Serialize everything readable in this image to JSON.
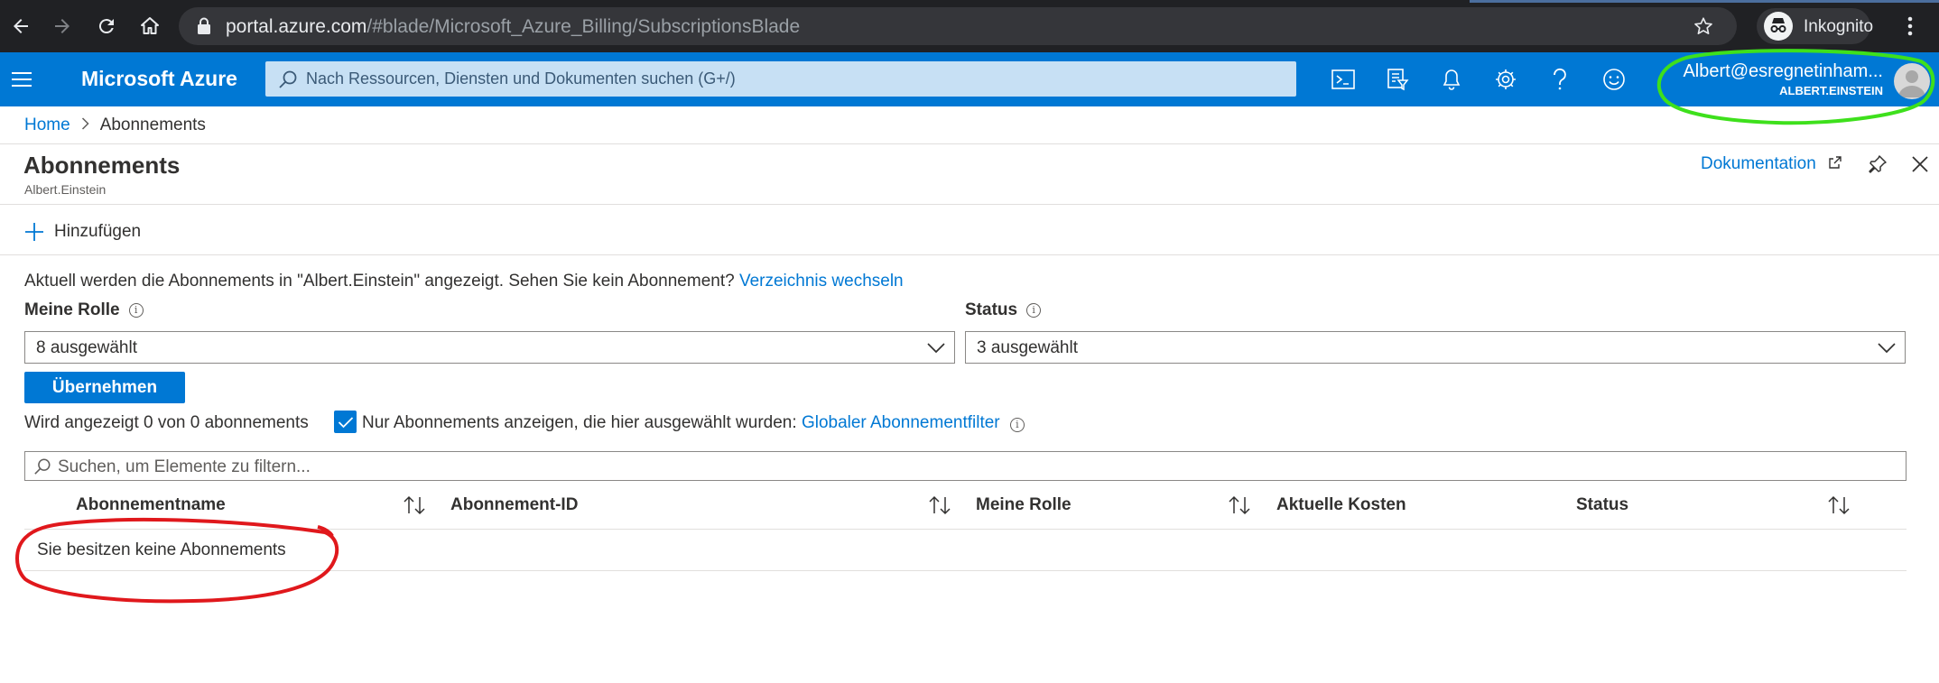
{
  "browser": {
    "url_host": "portal.azure.com",
    "url_path": "/#blade/Microsoft_Azure_Billing/SubscriptionsBlade",
    "profile_label": "Inkognito"
  },
  "header": {
    "brand": "Microsoft Azure",
    "search_placeholder": "Nach Ressourcen, Diensten und Dokumenten suchen (G+/)",
    "user_name": "Albert@esregnetinham...",
    "user_tenant": "ALBERT.EINSTEIN"
  },
  "breadcrumb": {
    "home": "Home",
    "current": "Abonnements"
  },
  "blade": {
    "title": "Abonnements",
    "subtitle": "Albert.Einstein",
    "doc_link": "Dokumentation"
  },
  "toolbar": {
    "add_label": "Hinzufügen"
  },
  "info": {
    "text": "Aktuell werden die Abonnements in \"Albert.Einstein\" angezeigt. Sehen Sie kein Abonnement?",
    "link": "Verzeichnis wechseln"
  },
  "filters": {
    "role_label": "Meine Rolle",
    "role_value": "8 ausgewählt",
    "status_label": "Status",
    "status_value": "3 ausgewählt",
    "apply_label": "Übernehmen"
  },
  "summary": {
    "showing": "Wird angezeigt 0 von 0 abonnements",
    "checkbox_checked": true,
    "checkbox_label": "Nur Abonnements anzeigen, die hier ausgewählt wurden:",
    "checkbox_link": "Globaler Abonnementfilter"
  },
  "table": {
    "filter_placeholder": "Suchen, um Elemente zu filtern...",
    "columns": [
      "Abonnementname",
      "Abonnement-ID",
      "Meine Rolle",
      "Aktuelle Kosten",
      "Status"
    ],
    "empty_message": "Sie besitzen keine Abonnements"
  },
  "colors": {
    "azure_blue": "#0078d4",
    "chrome_dark": "#202124",
    "highlight_green": "#3ee01c",
    "highlight_red": "#e0181c"
  }
}
